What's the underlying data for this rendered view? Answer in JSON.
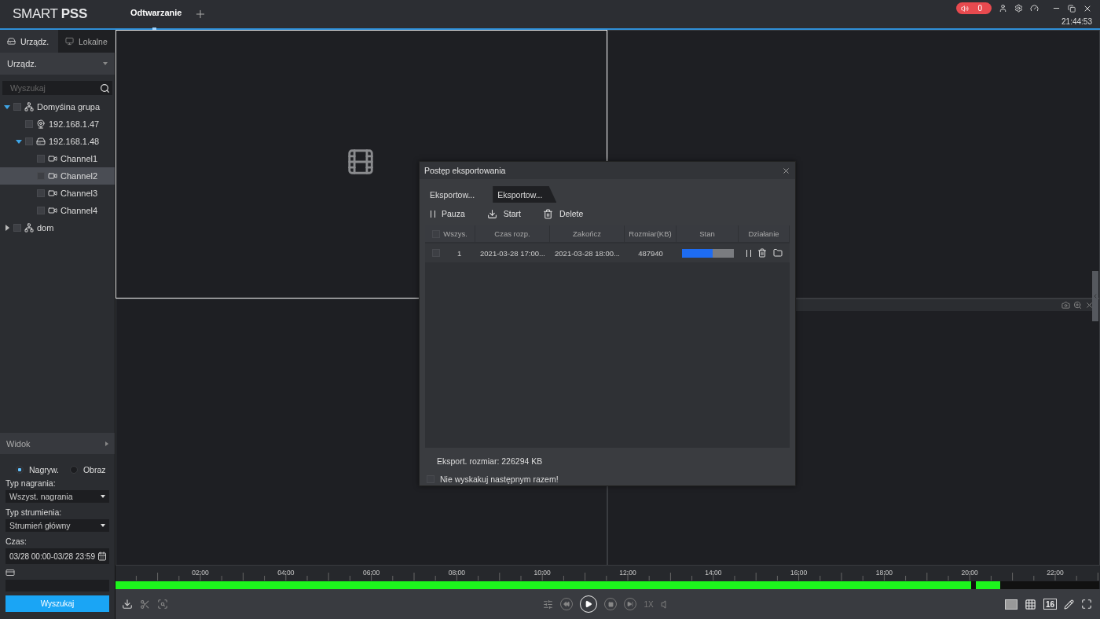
{
  "app": {
    "logo_light": "SMART",
    "logo_bold": "PSS"
  },
  "top_tabs": [
    {
      "label": "Odtwarzanie",
      "selected": true
    }
  ],
  "alarm": {
    "count": "0"
  },
  "clock": "21:44:53",
  "sidebar": {
    "tabs": [
      {
        "label": "Urządz.",
        "selected": true,
        "kind": "device"
      },
      {
        "label": "Lokalne",
        "selected": false,
        "kind": "local"
      }
    ],
    "dropdown": "Urządz.",
    "search": {
      "placeholder": "Wyszukaj"
    },
    "tree": [
      {
        "name": "Domyśina grupa",
        "kind": "group",
        "checked": false,
        "selected": false,
        "expanded": true,
        "children": [
          {
            "name": "192.168.1.47",
            "kind": "camera",
            "checked": false,
            "selected": false
          },
          {
            "name": "192.168.1.48",
            "kind": "recorder",
            "checked": false,
            "selected": false,
            "expanded": true,
            "children": [
              {
                "name": "Channel1",
                "kind": "channel",
                "checked": false,
                "selected": false
              },
              {
                "name": "Channel2",
                "kind": "channel",
                "checked": false,
                "selected": true
              },
              {
                "name": "Channel3",
                "kind": "channel",
                "checked": false,
                "selected": false
              },
              {
                "name": "Channel4",
                "kind": "channel",
                "checked": false,
                "selected": false
              }
            ]
          }
        ]
      },
      {
        "name": "dom",
        "kind": "group",
        "checked": false,
        "selected": false,
        "expanded": false
      }
    ],
    "view_section": "Widok",
    "radios": [
      {
        "label": "Nagryw.",
        "selected": true
      },
      {
        "label": "Obraz",
        "selected": false
      }
    ],
    "fields": [
      {
        "label": "Typ nagrania:",
        "value": "Wszyst. nagrania",
        "kind": "select"
      },
      {
        "label": "Typ strumienia:",
        "value": "Strumień główny",
        "kind": "select"
      },
      {
        "label": "Czas:",
        "value": "03/28 00:00-03/28 23:59",
        "kind": "date"
      }
    ],
    "search_button": "Wyszukaj"
  },
  "video_cells": [
    {
      "selected": true,
      "kind": "placeholder"
    },
    {
      "selected": false,
      "kind": "empty"
    },
    {
      "selected": false,
      "kind": "empty"
    },
    {
      "selected": false,
      "kind": "toolbar"
    }
  ],
  "dialog": {
    "title": "Postęp eksportowania",
    "tabs": [
      {
        "label": "Eksportow...",
        "selected": false
      },
      {
        "label": "Eksportow...",
        "selected": true
      }
    ],
    "actions": [
      {
        "label": "Pauza",
        "kind": "pause"
      },
      {
        "label": "Start",
        "kind": "start"
      },
      {
        "label": "Delete",
        "kind": "delete"
      }
    ],
    "all_checked": false,
    "columns": [
      "Wszys.",
      "Czas rozp.",
      "Zakończ",
      "Rozmiar(KB)",
      "Stan",
      "Działanie"
    ],
    "rows": [
      {
        "checked": false,
        "cells": [
          "1",
          "2021-03-28 17:00...",
          "2021-03-28 18:00...",
          "487940"
        ],
        "level": 0.6
      }
    ],
    "total": "Eksport. rozmiar: 226294 KB",
    "dont_show": {
      "label": "Nie wyskakuj następnym razem!",
      "checked": false
    }
  },
  "timeline": {
    "labels": [
      "02:00",
      "04:00",
      "06:00",
      "08:00",
      "10:00",
      "12:00",
      "14:00",
      "16:00",
      "18:00",
      "20:00",
      "22:00"
    ]
  },
  "controls": {
    "speed": "1X",
    "layout_16": "16"
  }
}
